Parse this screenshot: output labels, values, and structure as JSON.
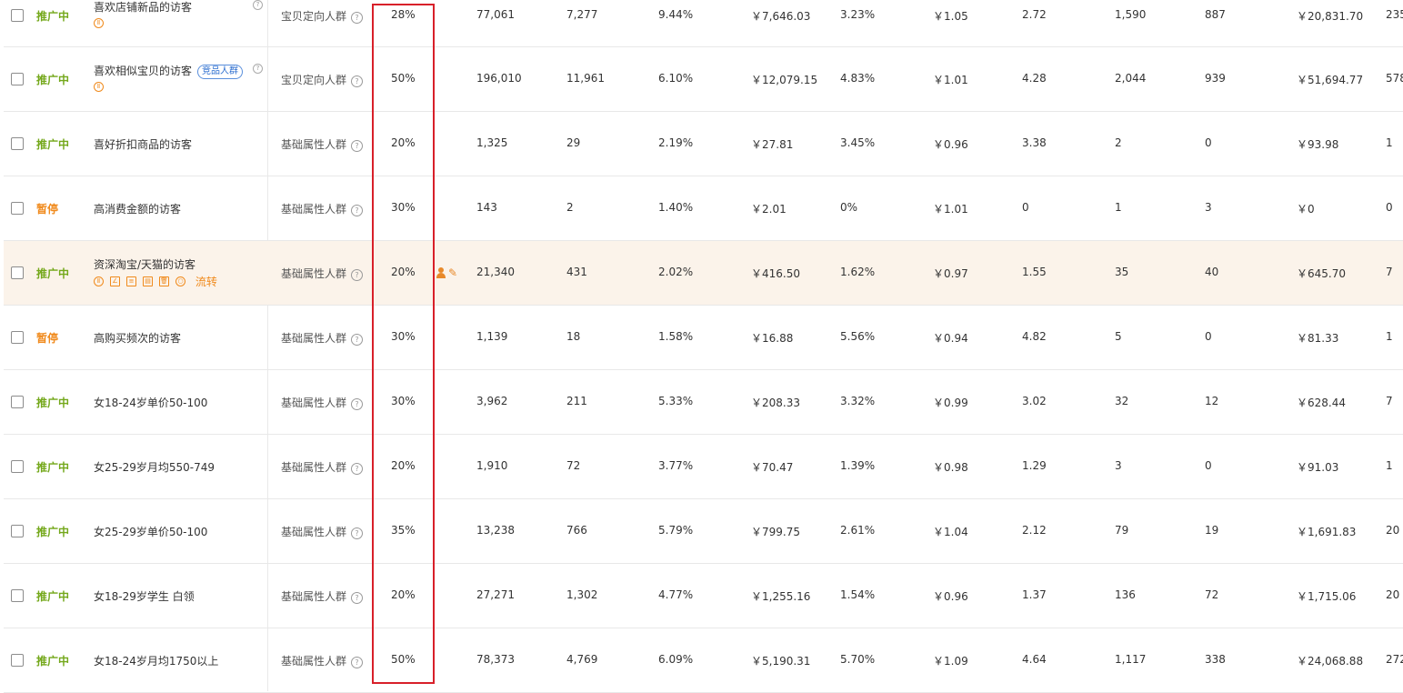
{
  "rows": [
    {
      "status": "推广中",
      "status_kind": "on",
      "name": "喜欢店铺新品的访客",
      "name_tag": "",
      "icons": [
        "pause"
      ],
      "type": "宝贝定向人群",
      "pct": "28%",
      "cols": [
        "77,061",
        "7,277",
        "9.44%",
        "￥7,646.03",
        "3.23%",
        "￥1.05",
        "2.72",
        "1,590",
        "887",
        "￥20,831.70",
        "235"
      ]
    },
    {
      "status": "推广中",
      "status_kind": "on",
      "name": "喜欢相似宝贝的访客",
      "name_tag": "竞品人群",
      "icons": [
        "pause"
      ],
      "type": "宝贝定向人群",
      "pct": "50%",
      "cols": [
        "196,010",
        "11,961",
        "6.10%",
        "￥12,079.15",
        "4.83%",
        "￥1.01",
        "4.28",
        "2,044",
        "939",
        "￥51,694.77",
        "578"
      ]
    },
    {
      "status": "推广中",
      "status_kind": "on",
      "name": "喜好折扣商品的访客",
      "name_tag": "",
      "icons": [],
      "type": "基础属性人群",
      "pct": "20%",
      "cols": [
        "1,325",
        "29",
        "2.19%",
        "￥27.81",
        "3.45%",
        "￥0.96",
        "3.38",
        "2",
        "0",
        "￥93.98",
        "1"
      ]
    },
    {
      "status": "暂停",
      "status_kind": "pause",
      "name": "高消费金额的访客",
      "name_tag": "",
      "icons": [],
      "type": "基础属性人群",
      "pct": "30%",
      "cols": [
        "143",
        "2",
        "1.40%",
        "￥2.01",
        "0%",
        "￥1.01",
        "0",
        "1",
        "3",
        "￥0",
        "0"
      ]
    },
    {
      "status": "推广中",
      "status_kind": "on",
      "name": "资深淘宝/天猫的访客",
      "name_tag": "",
      "icons": [
        "pause",
        "chart",
        "report",
        "doc",
        "delete",
        "flow"
      ],
      "flow_label": "流转",
      "type": "基础属性人群",
      "pct": "20%",
      "cols": [
        "21,340",
        "431",
        "2.02%",
        "￥416.50",
        "1.62%",
        "￥0.97",
        "1.55",
        "35",
        "40",
        "￥645.70",
        "7"
      ]
    },
    {
      "status": "暂停",
      "status_kind": "pause",
      "name": "高购买频次的访客",
      "name_tag": "",
      "icons": [],
      "type": "基础属性人群",
      "pct": "30%",
      "cols": [
        "1,139",
        "18",
        "1.58%",
        "￥16.88",
        "5.56%",
        "￥0.94",
        "4.82",
        "5",
        "0",
        "￥81.33",
        "1"
      ]
    },
    {
      "status": "推广中",
      "status_kind": "on",
      "name": "女18-24岁单价50-100",
      "name_tag": "",
      "icons": [],
      "type": "基础属性人群",
      "pct": "30%",
      "cols": [
        "3,962",
        "211",
        "5.33%",
        "￥208.33",
        "3.32%",
        "￥0.99",
        "3.02",
        "32",
        "12",
        "￥628.44",
        "7"
      ]
    },
    {
      "status": "推广中",
      "status_kind": "on",
      "name": "女25-29岁月均550-749",
      "name_tag": "",
      "icons": [],
      "type": "基础属性人群",
      "pct": "20%",
      "cols": [
        "1,910",
        "72",
        "3.77%",
        "￥70.47",
        "1.39%",
        "￥0.98",
        "1.29",
        "3",
        "0",
        "￥91.03",
        "1"
      ]
    },
    {
      "status": "推广中",
      "status_kind": "on",
      "name": "女25-29岁单价50-100",
      "name_tag": "",
      "icons": [],
      "type": "基础属性人群",
      "pct": "35%",
      "cols": [
        "13,238",
        "766",
        "5.79%",
        "￥799.75",
        "2.61%",
        "￥1.04",
        "2.12",
        "79",
        "19",
        "￥1,691.83",
        "20"
      ]
    },
    {
      "status": "推广中",
      "status_kind": "on",
      "name": "女18-29岁学生 白领",
      "name_tag": "",
      "icons": [],
      "type": "基础属性人群",
      "pct": "20%",
      "cols": [
        "27,271",
        "1,302",
        "4.77%",
        "￥1,255.16",
        "1.54%",
        "￥0.96",
        "1.37",
        "136",
        "72",
        "￥1,715.06",
        "20"
      ]
    },
    {
      "status": "推广中",
      "status_kind": "on",
      "name": "女18-24岁月均1750以上",
      "name_tag": "",
      "icons": [],
      "type": "基础属性人群",
      "pct": "50%",
      "cols": [
        "78,373",
        "4,769",
        "6.09%",
        "￥5,190.31",
        "5.70%",
        "￥1.09",
        "4.64",
        "1,117",
        "338",
        "￥24,068.88",
        "272"
      ]
    }
  ],
  "highlight": {
    "row_index": 4,
    "background": "#fbf3ea"
  },
  "annotation": {
    "color": "#d8202a",
    "target": "premium-percent-column"
  },
  "colors": {
    "status_on": "#74a81b",
    "status_pause": "#f08a1c",
    "tag": "#2b6dcf",
    "icon_orange": "#f08a1c"
  }
}
